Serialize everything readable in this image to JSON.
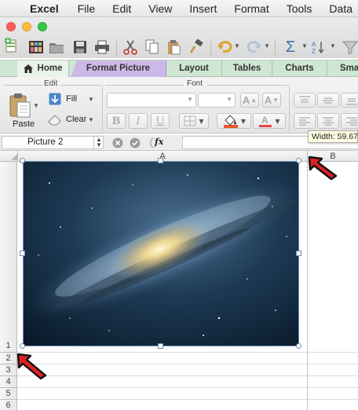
{
  "menubar": {
    "app_name": "Excel",
    "items": [
      "File",
      "Edit",
      "View",
      "Insert",
      "Format",
      "Tools",
      "Data"
    ]
  },
  "ribbon": {
    "tabs": [
      "Home",
      "Format Picture",
      "Layout",
      "Tables",
      "Charts",
      "Sma"
    ],
    "active_tab": "Home",
    "edit_group": {
      "title": "Edit",
      "paste_label": "Paste",
      "fill_label": "Fill",
      "clear_label": "Clear"
    },
    "font_group": {
      "title": "Font",
      "bold": "B",
      "italic": "I",
      "underline": "U",
      "grow": "A",
      "shrink": "A"
    }
  },
  "formula_bar": {
    "name_box": "Picture 2",
    "fx": "fx"
  },
  "tooltip": {
    "text": "Width: 59.67"
  },
  "sheet": {
    "columns": [
      "A",
      "B"
    ],
    "rows": [
      "1",
      "2",
      "3",
      "4",
      "5",
      "6"
    ]
  },
  "colors": {
    "tab_bar": "#cfe6d2",
    "format_picture_tab": "#cdb9e8",
    "selection_handle": "#6f8fb3",
    "annotation_arrow": "#e02020"
  }
}
